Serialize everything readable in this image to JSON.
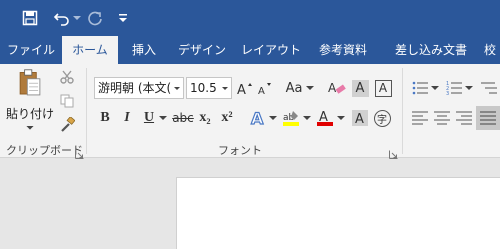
{
  "tabs": [
    "ファイル",
    "ホーム",
    "挿入",
    "デザイン",
    "レイアウト",
    "参考資料",
    "差し込み文書",
    "校"
  ],
  "clipboard": {
    "paste_label": "貼り付け",
    "group_label": "クリップボード"
  },
  "font": {
    "name": "游明朝 (本文(",
    "size": "10.5",
    "case_label": "Aa",
    "group_label": "フォント",
    "char_border_label": "A",
    "char_shading_label": "A",
    "enclose_label": "字",
    "bold_label": "B",
    "italic_label": "I",
    "underline_label": "U",
    "strike_label": "abc",
    "subscript_label": "x₂",
    "superscript_label": "x²"
  },
  "colors": {
    "brand": "#2b579a",
    "highlight": "#ffff00",
    "font_color": "#e00000"
  }
}
